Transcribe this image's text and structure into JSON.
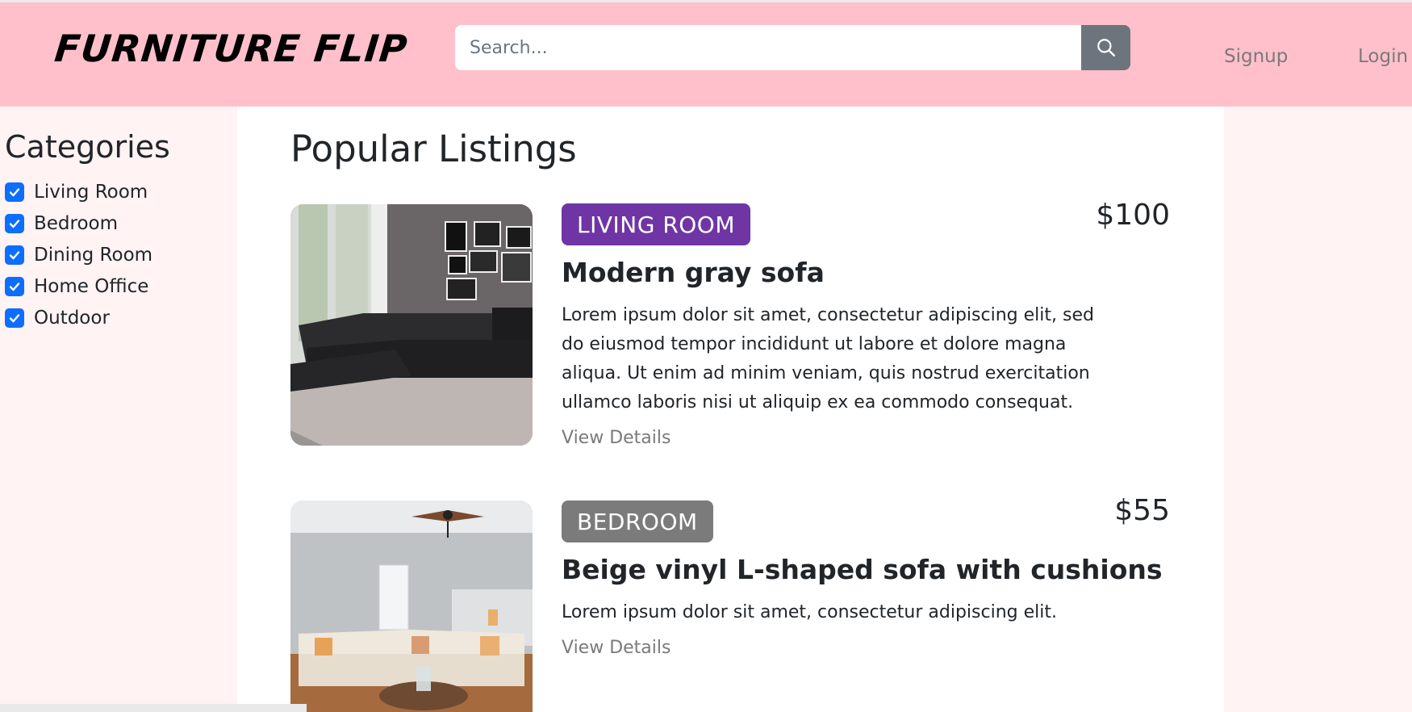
{
  "header": {
    "brand": "FURNITURE FLIP",
    "search_placeholder": "Search...",
    "search_icon": "search-icon",
    "nav": {
      "signup": "Signup",
      "login": "Login"
    }
  },
  "sidebar": {
    "title": "Categories",
    "items": [
      {
        "label": "Living Room",
        "checked": true
      },
      {
        "label": "Bedroom",
        "checked": true
      },
      {
        "label": "Dining Room",
        "checked": true
      },
      {
        "label": "Home Office",
        "checked": true
      },
      {
        "label": "Outdoor",
        "checked": true
      }
    ]
  },
  "main": {
    "title": "Popular Listings",
    "listings": [
      {
        "category": "LIVING ROOM",
        "category_color": "#6f35a5",
        "price": "$100",
        "title": "Modern gray sofa",
        "description": "Lorem ipsum dolor sit amet, consectetur adipiscing elit, sed do eiusmod tempor incididunt ut labore et dolore magna aliqua. Ut enim ad minim veniam, quis nostrud exercitation ullamco laboris nisi ut aliquip ex ea commodo consequat.",
        "link": "View Details"
      },
      {
        "category": "BEDROOM",
        "category_color": "#7b7b7b",
        "price": "$55",
        "title": "Beige vinyl L-shaped sofa with cushions",
        "description": "Lorem ipsum dolor sit amet, consectetur adipiscing elit.",
        "link": "View Details"
      }
    ]
  },
  "colors": {
    "navbar_bg": "#ffc0cb",
    "sidebar_bg": "#fff3f3",
    "checkbox": "#0d6efd",
    "search_button": "#6c757d"
  }
}
